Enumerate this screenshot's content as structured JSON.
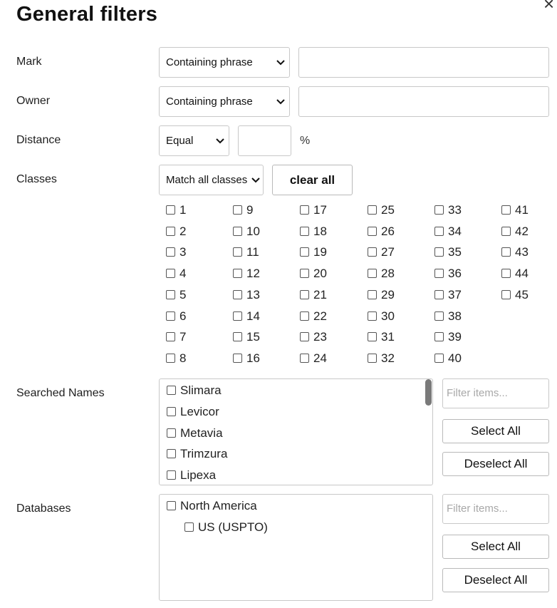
{
  "title": "General filters",
  "close_glyph": "×",
  "mark": {
    "label": "Mark",
    "operator": "Containing phrase",
    "value": ""
  },
  "owner": {
    "label": "Owner",
    "operator": "Containing phrase",
    "value": ""
  },
  "distance": {
    "label": "Distance",
    "operator": "Equal",
    "value": "",
    "unit": "%"
  },
  "classes": {
    "label": "Classes",
    "mode": "Match all classes",
    "clear_label": "clear all",
    "items": [
      "1",
      "2",
      "3",
      "4",
      "5",
      "6",
      "7",
      "8",
      "9",
      "10",
      "11",
      "12",
      "13",
      "14",
      "15",
      "16",
      "17",
      "18",
      "19",
      "20",
      "21",
      "22",
      "23",
      "24",
      "25",
      "26",
      "27",
      "28",
      "29",
      "30",
      "31",
      "32",
      "33",
      "34",
      "35",
      "36",
      "37",
      "38",
      "39",
      "40",
      "41",
      "42",
      "43",
      "44",
      "45"
    ]
  },
  "searched_names": {
    "label": "Searched Names",
    "items": [
      "Slimara",
      "Levicor",
      "Metavia",
      "Trimzura",
      "Lipexa"
    ],
    "filter_placeholder": "Filter items...",
    "select_all": "Select All",
    "deselect_all": "Deselect All"
  },
  "databases": {
    "label": "Databases",
    "items": [
      "North America",
      "US (USPTO)"
    ],
    "filter_placeholder": "Filter items...",
    "select_all": "Select All",
    "deselect_all": "Deselect All"
  },
  "icons": {
    "dropdown": "chevron-down-icon",
    "close": "close-icon",
    "checkbox": "checkbox-icon"
  }
}
